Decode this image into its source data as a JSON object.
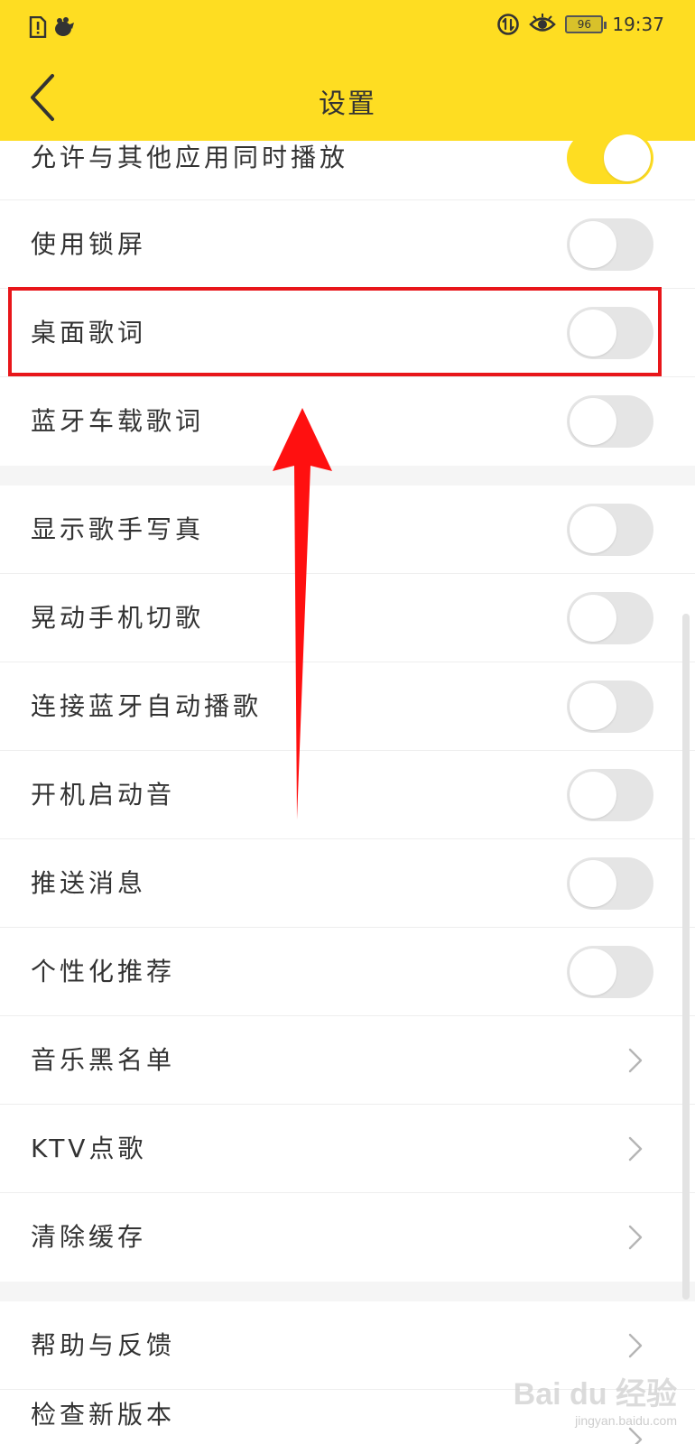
{
  "status_bar": {
    "time": "19:37",
    "battery": "96",
    "icons_left": [
      "alert-doc-icon",
      "bug-icon"
    ],
    "icons_right": [
      "data-sync-icon",
      "eye-icon"
    ]
  },
  "header": {
    "title": "设置",
    "back_icon": "chevron-left-icon"
  },
  "settings": {
    "items": [
      {
        "label": "允许与其他应用同时播放",
        "control": "toggle",
        "on": true
      },
      {
        "label": "使用锁屏",
        "control": "toggle",
        "on": false
      },
      {
        "label": "桌面歌词",
        "control": "toggle",
        "on": false,
        "highlighted": true
      },
      {
        "label": "蓝牙车载歌词",
        "control": "toggle",
        "on": false
      },
      {
        "label": "显示歌手写真",
        "control": "toggle",
        "on": false
      },
      {
        "label": "晃动手机切歌",
        "control": "toggle",
        "on": false
      },
      {
        "label": "连接蓝牙自动播歌",
        "control": "toggle",
        "on": false
      },
      {
        "label": "开机启动音",
        "control": "toggle",
        "on": false
      },
      {
        "label": "推送消息",
        "control": "toggle",
        "on": false
      },
      {
        "label": "个性化推荐",
        "control": "toggle",
        "on": false
      },
      {
        "label": "音乐黑名单",
        "control": "chevron"
      },
      {
        "label": "KTV点歌",
        "control": "chevron"
      },
      {
        "label": "清除缓存",
        "control": "chevron"
      },
      {
        "label": "帮助与反馈",
        "control": "chevron"
      },
      {
        "label": "检查新版本",
        "control": "chevron"
      }
    ]
  },
  "watermark": {
    "main": "Bai du 经验",
    "sub": "jingyan.baidu.com"
  },
  "colors": {
    "accent": "#FEDD22",
    "annotation": "#E8161A",
    "toggle_off": "#E5E5E5"
  }
}
